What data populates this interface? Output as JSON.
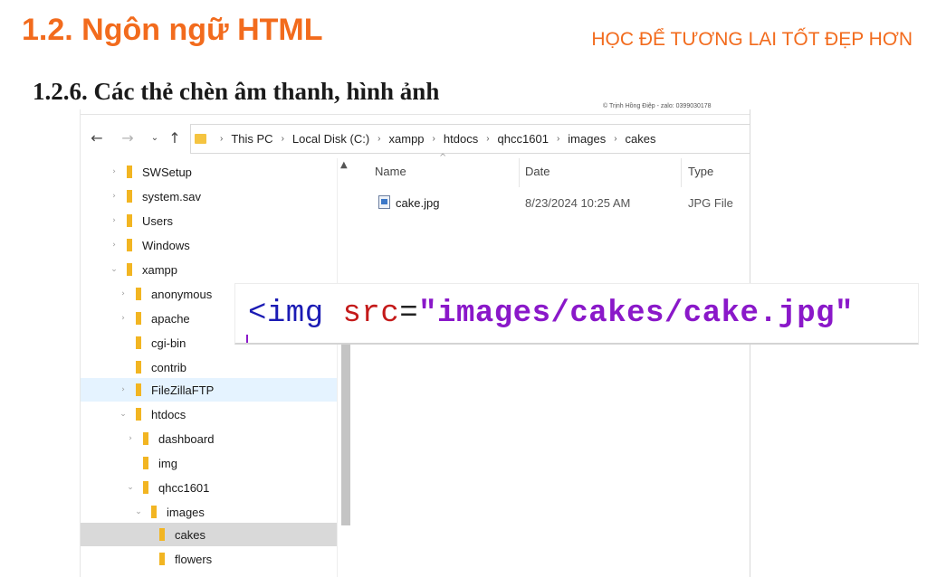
{
  "slide": {
    "title": "1.2. Ngôn ngữ HTML",
    "slogan": "HỌC ĐỂ TƯƠNG LAI TỐT ĐẸP HƠN",
    "section_heading": "1.2.6. Các thẻ chèn âm thanh, hình ảnh",
    "watermark": "© Trịnh Hồng Điệp - zalo: 0399030178"
  },
  "explorer": {
    "breadcrumbs": [
      "This PC",
      "Local Disk (C:)",
      "xampp",
      "htdocs",
      "qhcc1601",
      "images",
      "cakes"
    ],
    "nav_tree": [
      {
        "label": "SWSetup",
        "expanded": false,
        "selected": false,
        "highlighted": false
      },
      {
        "label": "system.sav",
        "expanded": false,
        "selected": false,
        "highlighted": false
      },
      {
        "label": "Users",
        "expanded": false,
        "selected": false,
        "highlighted": false
      },
      {
        "label": "Windows",
        "expanded": false,
        "selected": false,
        "highlighted": false
      },
      {
        "label": "xampp",
        "expanded": true,
        "selected": false,
        "highlighted": false
      },
      {
        "label": "anonymous",
        "expanded": false,
        "selected": false,
        "highlighted": false
      },
      {
        "label": "apache",
        "expanded": false,
        "selected": false,
        "highlighted": false
      },
      {
        "label": "cgi-bin",
        "expanded": false,
        "selected": false,
        "highlighted": false
      },
      {
        "label": "contrib",
        "expanded": false,
        "selected": false,
        "highlighted": false
      },
      {
        "label": "FileZillaFTP",
        "expanded": false,
        "selected": false,
        "highlighted": true
      },
      {
        "label": "htdocs",
        "expanded": true,
        "selected": false,
        "highlighted": false
      },
      {
        "label": "dashboard",
        "expanded": false,
        "selected": false,
        "highlighted": false
      },
      {
        "label": "img",
        "expanded": false,
        "selected": false,
        "highlighted": false
      },
      {
        "label": "qhcc1601",
        "expanded": true,
        "selected": false,
        "highlighted": false
      },
      {
        "label": "images",
        "expanded": true,
        "selected": false,
        "highlighted": false
      },
      {
        "label": "cakes",
        "expanded": false,
        "selected": true,
        "highlighted": false
      },
      {
        "label": "flowers",
        "expanded": false,
        "selected": false,
        "highlighted": false
      }
    ],
    "columns": {
      "name": "Name",
      "date": "Date",
      "type": "Type"
    },
    "files": [
      {
        "name": "cake.jpg",
        "date": "8/23/2024 10:25 AM",
        "type": "JPG File"
      }
    ],
    "icons": {
      "back": "back-arrow-icon",
      "forward": "forward-arrow-icon",
      "recent": "chevron-down-icon",
      "up": "up-arrow-icon",
      "file": "image-file-icon",
      "folder": "folder-icon"
    }
  },
  "code": {
    "tag": "<img ",
    "attr": "src",
    "eq": "=",
    "value": "\"images/cakes/cake.jpg\""
  },
  "colors": {
    "accent_orange": "#f26b1d",
    "folder_yellow": "#f2b522",
    "code_tag": "#1b1bb4",
    "code_attr": "#c41a1a",
    "code_value": "#8a18c9"
  }
}
